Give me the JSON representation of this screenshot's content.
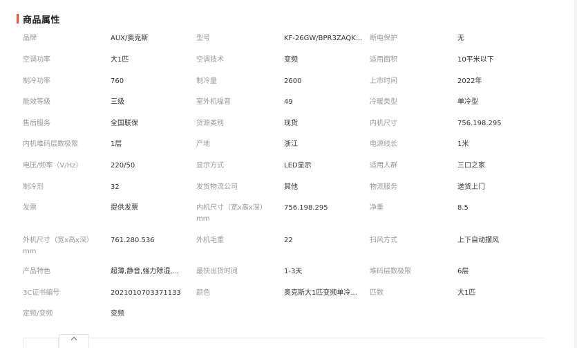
{
  "section": {
    "title": "商品属性"
  },
  "properties": [
    [
      {
        "label": "品牌",
        "value": "AUX/奥克斯"
      },
      {
        "label": "型号",
        "value": "KF-26GW/BPR3ZAQK..."
      },
      {
        "label": "断电保护",
        "value": "无"
      }
    ],
    [
      {
        "label": "空调功率",
        "value": "大1匹"
      },
      {
        "label": "空调技术",
        "value": "变频"
      },
      {
        "label": "适用面积",
        "value": "10平米以下"
      }
    ],
    [
      {
        "label": "制冷功率",
        "value": "760"
      },
      {
        "label": "制冷量",
        "value": "2600"
      },
      {
        "label": "上市时间",
        "value": "2022年"
      }
    ],
    [
      {
        "label": "能效等级",
        "value": "三级"
      },
      {
        "label": "室外机噪音",
        "value": "49"
      },
      {
        "label": "冷暖类型",
        "value": "单冷型"
      }
    ],
    [
      {
        "label": "售后服务",
        "value": "全国联保"
      },
      {
        "label": "货源类别",
        "value": "现货"
      },
      {
        "label": "内机尺寸",
        "value": "756.198.295"
      }
    ],
    [
      {
        "label": "内机堆码层数极限",
        "value": "1层"
      },
      {
        "label": "产地",
        "value": "浙江"
      },
      {
        "label": "电源线长",
        "value": "1米"
      }
    ],
    [
      {
        "label": "电压/频率（V/Hz）",
        "value": "220/50"
      },
      {
        "label": "显示方式",
        "value": "LED显示"
      },
      {
        "label": "适用人群",
        "value": "三口之家"
      }
    ],
    [
      {
        "label": "制冷剂",
        "value": "32"
      },
      {
        "label": "发货物流公司",
        "value": "其他"
      },
      {
        "label": "物流服务",
        "value": "送货上门"
      }
    ],
    [
      {
        "label": "发票",
        "value": "提供发票"
      },
      {
        "label": "内机尺寸（宽x高x深）mm",
        "value": "756.198.295"
      },
      {
        "label": "净重",
        "value": "8.5"
      }
    ],
    [
      {
        "label": "外机尺寸（宽x高x深）mm",
        "value": "761.280.536"
      },
      {
        "label": "外机毛重",
        "value": "22"
      },
      {
        "label": "扫风方式",
        "value": "上下自动摆风"
      }
    ],
    [
      {
        "label": "产品特色",
        "value": "超薄,静音,强力除湿,..."
      },
      {
        "label": "最快出货时间",
        "value": "1-3天"
      },
      {
        "label": "堆码层数极限",
        "value": "6层"
      }
    ],
    [
      {
        "label": "3C证书编号",
        "value": "2021010703371133"
      },
      {
        "label": "颜色",
        "value": "奥克斯大1匹变频单冷..."
      },
      {
        "label": "匹数",
        "value": "大1匹"
      }
    ],
    [
      {
        "label": "定频/变频",
        "value": "变频"
      }
    ]
  ]
}
